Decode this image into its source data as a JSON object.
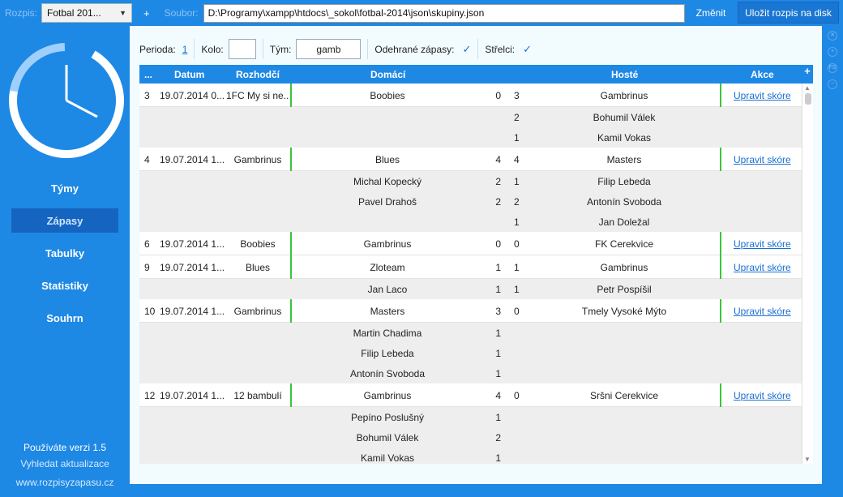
{
  "topbar": {
    "rozpis_label": "Rozpis:",
    "rozpis_value": "Fotbal 201...",
    "plus": "+",
    "soubor_label": "Soubor:",
    "soubor_value": "D:\\Programy\\xampp\\htdocs\\_sokol\\fotbal-2014\\json\\skupiny.json",
    "zmenit": "Změnit",
    "ulozit": "Uložit rozpis na disk"
  },
  "sidebar": {
    "items": [
      {
        "label": "Týmy"
      },
      {
        "label": "Zápasy"
      },
      {
        "label": "Tabulky"
      },
      {
        "label": "Statistiky"
      },
      {
        "label": "Souhrn"
      }
    ],
    "active_index": 1,
    "version": "Používáte verzi 1.5",
    "update": "Vyhledat aktualizace",
    "web": "www.rozpisyzapasu.cz"
  },
  "filters": {
    "perioda_label": "Perioda:",
    "perioda_value": "1",
    "kolo_label": "Kolo:",
    "kolo_value": "",
    "tym_label": "Tým:",
    "tym_value": "gamb",
    "odehrane_label": "Odehrané zápasy:",
    "strelci_label": "Střelci:",
    "check": "✓"
  },
  "table": {
    "headers": {
      "num": "...",
      "datum": "Datum",
      "rozhodci": "Rozhodčí",
      "domaci": "Domácí",
      "hoste": "Hosté",
      "akce": "Akce",
      "plus": "+"
    },
    "action_label": "Upravit skóre",
    "rows": [
      {
        "type": "match",
        "num": "3",
        "datum": "19.07.2014 0...",
        "rozhodci": "1FC My si ne...",
        "domaci": "Boobies",
        "gd": "0",
        "gh": "3",
        "hoste": "Gambrinus"
      },
      {
        "type": "sub",
        "domaci": "",
        "gd": "",
        "gh": "2",
        "hoste": "Bohumil Válek"
      },
      {
        "type": "sub",
        "domaci": "",
        "gd": "",
        "gh": "1",
        "hoste": "Kamil Vokas"
      },
      {
        "type": "match",
        "num": "4",
        "datum": "19.07.2014 1...",
        "rozhodci": "Gambrinus",
        "domaci": "Blues",
        "gd": "4",
        "gh": "4",
        "hoste": "Masters"
      },
      {
        "type": "sub",
        "domaci": "Michal Kopecký",
        "gd": "2",
        "gh": "1",
        "hoste": "Filip Lebeda"
      },
      {
        "type": "sub",
        "domaci": "Pavel Drahoš",
        "gd": "2",
        "gh": "2",
        "hoste": "Antonín Svoboda"
      },
      {
        "type": "sub",
        "domaci": "",
        "gd": "",
        "gh": "1",
        "hoste": "Jan Doležal"
      },
      {
        "type": "match",
        "num": "6",
        "datum": "19.07.2014 1...",
        "rozhodci": "Boobies",
        "domaci": "Gambrinus",
        "gd": "0",
        "gh": "0",
        "hoste": "FK Cerekvice"
      },
      {
        "type": "match",
        "num": "9",
        "datum": "19.07.2014 1...",
        "rozhodci": "Blues",
        "domaci": "Zloteam",
        "gd": "1",
        "gh": "1",
        "hoste": "Gambrinus"
      },
      {
        "type": "sub",
        "domaci": "Jan Laco",
        "gd": "1",
        "gh": "1",
        "hoste": "Petr Pospíšil"
      },
      {
        "type": "match",
        "num": "10",
        "datum": "19.07.2014 1...",
        "rozhodci": "Gambrinus",
        "domaci": "Masters",
        "gd": "3",
        "gh": "0",
        "hoste": "Tmely Vysoké Mýto"
      },
      {
        "type": "sub",
        "domaci": "Martin Chadima",
        "gd": "1",
        "gh": "",
        "hoste": ""
      },
      {
        "type": "sub",
        "domaci": "Filip Lebeda",
        "gd": "1",
        "gh": "",
        "hoste": ""
      },
      {
        "type": "sub",
        "domaci": "Antonín Svoboda",
        "gd": "1",
        "gh": "",
        "hoste": ""
      },
      {
        "type": "match",
        "num": "12",
        "datum": "19.07.2014 1...",
        "rozhodci": "12 bambulí",
        "domaci": "Gambrinus",
        "gd": "4",
        "gh": "0",
        "hoste": "Sršni Cerekvice"
      },
      {
        "type": "sub",
        "domaci": "Pepíno Poslušný",
        "gd": "1",
        "gh": "",
        "hoste": ""
      },
      {
        "type": "sub",
        "domaci": "Bohumil Válek",
        "gd": "2",
        "gh": "",
        "hoste": ""
      },
      {
        "type": "sub",
        "domaci": "Kamil Vokas",
        "gd": "1",
        "gh": "",
        "hoste": ""
      }
    ]
  },
  "right_strip_icons": [
    "close-icon",
    "add-icon",
    "fullscreen-icon",
    "minus-icon"
  ],
  "right_strip_glyphs": [
    "✕",
    "+",
    "FS",
    "−"
  ]
}
